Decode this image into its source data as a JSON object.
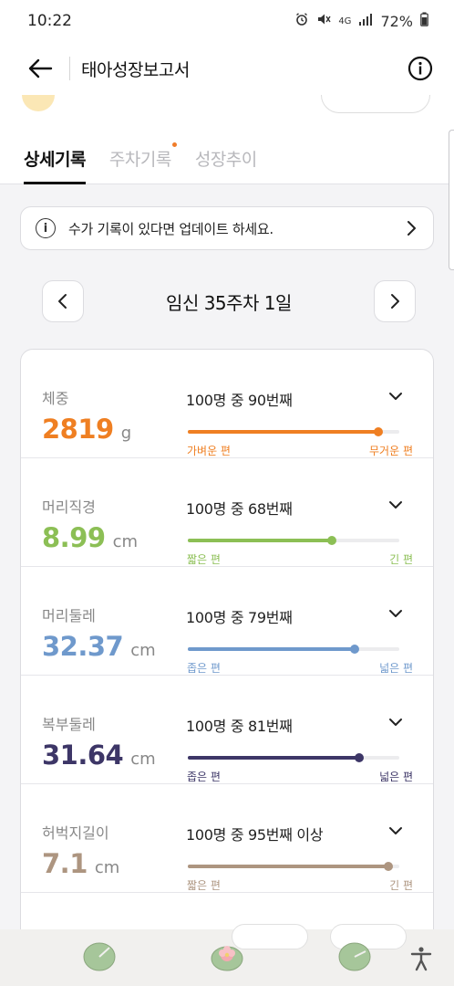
{
  "status": {
    "time": "10:22",
    "network": "4G",
    "battery": "72%"
  },
  "header": {
    "title": "태아성장보고서"
  },
  "tabs": [
    {
      "label": "상세기록",
      "active": true
    },
    {
      "label": "주차기록",
      "active": false,
      "has_dot": true
    },
    {
      "label": "성장추이",
      "active": false
    }
  ],
  "notice": {
    "icon": "i",
    "text": "수가 기록이 있다면 업데이트 하세요."
  },
  "week": {
    "label": "임신 35주차 1일"
  },
  "measurements": [
    {
      "label": "체중",
      "value": "2819",
      "unit": "g",
      "rank": "100명 중 90번째",
      "percentile": 0.9,
      "low_label": "가벼운 편",
      "high_label": "무거운 편",
      "color": "#ef7f22"
    },
    {
      "label": "머리직경",
      "value": "8.99",
      "unit": "cm",
      "rank": "100명 중 68번째",
      "percentile": 0.68,
      "low_label": "짧은 편",
      "high_label": "긴 편",
      "color": "#8cbf55"
    },
    {
      "label": "머리둘레",
      "value": "32.37",
      "unit": "cm",
      "rank": "100명 중 79번째",
      "percentile": 0.79,
      "low_label": "좁은 편",
      "high_label": "넓은 편",
      "color": "#6f99cc"
    },
    {
      "label": "복부둘레",
      "value": "31.64",
      "unit": "cm",
      "rank": "100명 중 81번째",
      "percentile": 0.81,
      "low_label": "좁은 편",
      "high_label": "넓은 편",
      "color": "#3d3667"
    },
    {
      "label": "허벅지길이",
      "value": "7.1",
      "unit": "cm",
      "rank": "100명 중 95번째 이상",
      "percentile": 0.95,
      "low_label": "짧은 편",
      "high_label": "긴 편",
      "color": "#ad9580"
    }
  ]
}
